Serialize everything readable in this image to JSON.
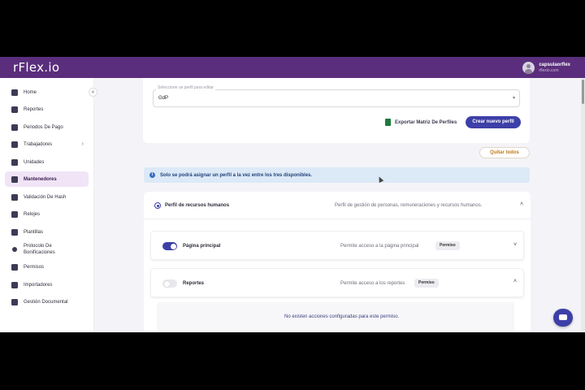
{
  "header": {
    "brand": "rFlex.io",
    "user_name": "capsulaorflex",
    "user_sub": "rflexio.com"
  },
  "sidebar": {
    "items": [
      {
        "label": "Home",
        "icon": "chart-line-icon"
      },
      {
        "label": "Reportes",
        "icon": "report-icon"
      },
      {
        "label": "Periodos De Pago",
        "icon": "calendar-icon"
      },
      {
        "label": "Trabajadores",
        "icon": "users-icon",
        "has_submenu": true
      },
      {
        "label": "Unidades",
        "icon": "sitemap-icon"
      },
      {
        "label": "Mantenedores",
        "icon": "lock-icon",
        "active": true
      },
      {
        "label": "Validación De Hash",
        "icon": "hash-icon"
      },
      {
        "label": "Relojes",
        "icon": "clock-icon"
      },
      {
        "label": "Plantillas",
        "icon": "template-icon"
      },
      {
        "label": "Protocolo De Bonificaciones",
        "icon": "dot-icon"
      },
      {
        "label": "Permisos",
        "icon": "permission-icon"
      },
      {
        "label": "Importadores",
        "icon": "download-icon"
      },
      {
        "label": "Gestión Documental",
        "icon": "document-icon"
      }
    ]
  },
  "profile_select": {
    "label": "Seleccione un perfil para editar",
    "value": "GdP"
  },
  "actions": {
    "export": "Exportar Matriz De Perfiles",
    "create": "Crear nuevo perfil",
    "clear": "Quitar todos"
  },
  "info": {
    "text": "Solo se podrá asignar un perfil a la vez entre los tres disponibles."
  },
  "profile": {
    "name": "Perfil de recursos humanos",
    "description": "Perfil de gestión de personas, remuneraciones y recursos humanos."
  },
  "permissions": [
    {
      "title": "Página principal",
      "description": "Permite acceso a la página principal",
      "badge": "Permiso",
      "enabled": true
    },
    {
      "title": "Reportes",
      "description": "Permite acceso a los reportes",
      "badge": "Permiso",
      "enabled": false
    }
  ],
  "empty_state": "No existen acciones configuradas para este permiso.",
  "colors": {
    "header": "#5a2e7c",
    "primary": "#3d3fa8",
    "active_nav": "#f1e4f7",
    "info_bg": "#dce9f7",
    "warning_text": "#c07a14"
  }
}
